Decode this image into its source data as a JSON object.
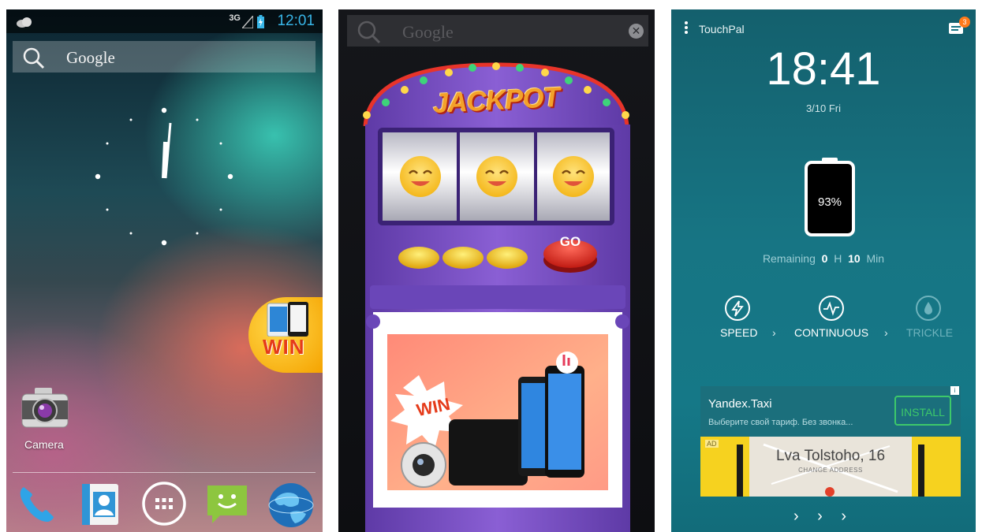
{
  "panel_home": {
    "status_network": "3G",
    "status_time": "12:01",
    "search_label": "Google",
    "promo_label": "WIN",
    "camera_label": "Camera",
    "dock_icons": [
      "phone-icon",
      "contacts-icon",
      "app-drawer-icon",
      "messaging-icon",
      "browser-icon"
    ]
  },
  "panel_jackpot": {
    "search_label": "Google",
    "close_glyph": "✕",
    "title": "JACKPOT",
    "go_label": "GO",
    "win_label": "WIN"
  },
  "panel_touchpal": {
    "app_name": "TouchPal",
    "notification_count": "3",
    "time": "18:41",
    "date": "3/10 Fri",
    "battery_percent": "93%",
    "battery_level": 0.93,
    "remaining": {
      "prefix": "Remaining",
      "hours": "0",
      "h_unit": "H",
      "minutes": "10",
      "min_unit": "Min"
    },
    "modes": [
      {
        "label": "SPEED",
        "icon": "bolt-icon",
        "active": true
      },
      {
        "label": "CONTINUOUS",
        "icon": "pulse-icon",
        "active": true
      },
      {
        "label": "TRICKLE",
        "icon": "drop-icon",
        "active": false
      }
    ],
    "chevron": "›",
    "ad": {
      "title": "Yandex.Taxi",
      "description": "Выберите свой тариф. Без звонка...",
      "install_label": "INSTALL",
      "info_glyph": "i",
      "badge": "AD",
      "address": "Lva Tolstoho, 16",
      "address_sub": "CHANGE ADDRESS"
    },
    "bottom_arrows": "› › ›"
  },
  "colors": {
    "status_time_blue": "#38b6e8",
    "touchpal_teal": "#177584",
    "install_green": "#3dc96a",
    "badge_orange": "#ff7a1a",
    "jackpot_purple": "#7a4fc4"
  }
}
